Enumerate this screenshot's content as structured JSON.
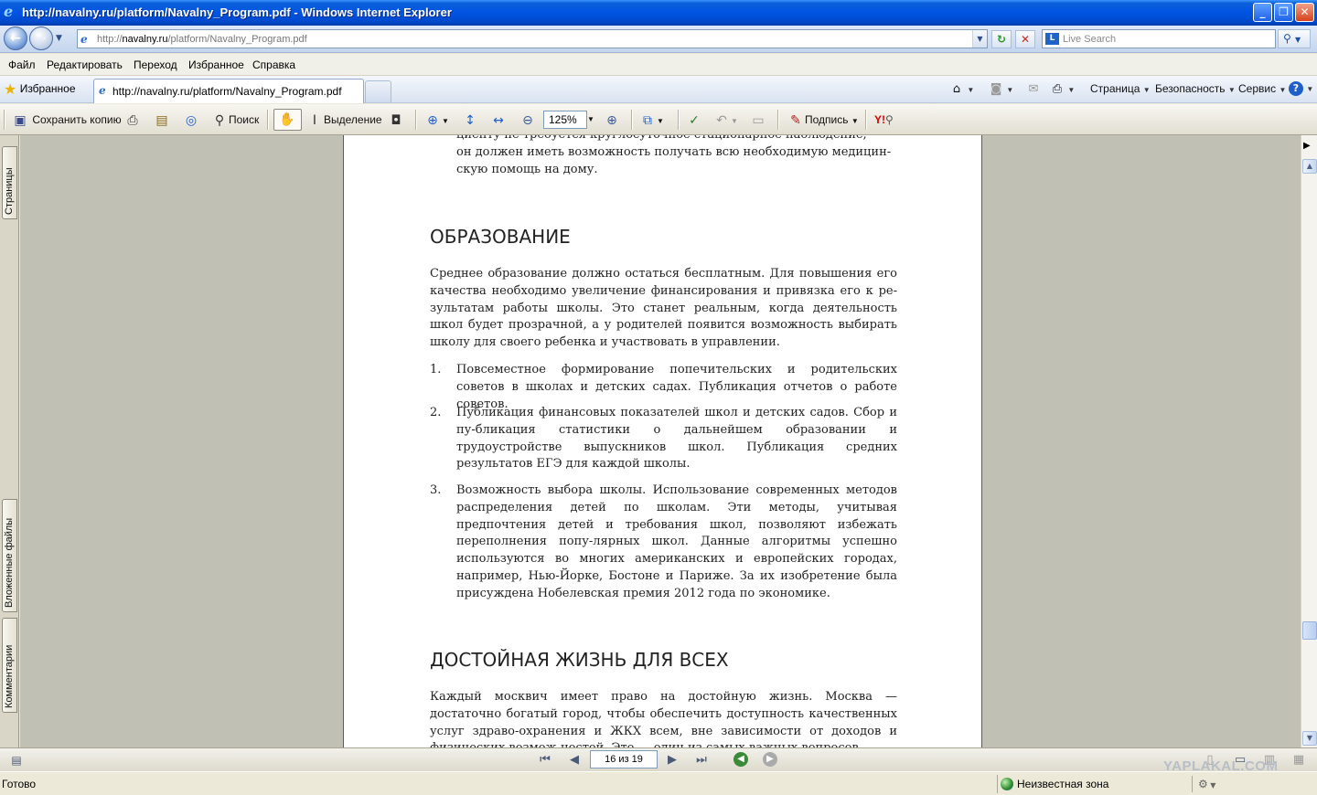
{
  "window": {
    "title": "http://navalny.ru/platform/Navalny_Program.pdf - Windows Internet Explorer"
  },
  "address": {
    "prefix": "http://",
    "domain": "navalny.ru",
    "path": "/platform/Navalny_Program.pdf"
  },
  "search": {
    "placeholder": "Live Search"
  },
  "menu": [
    "Файл",
    "Редактировать",
    "Переход",
    "Избранное",
    "Справка"
  ],
  "favorites_label": "Избранное",
  "tab_label": "http://navalny.ru/platform/Navalny_Program.pdf",
  "commands": {
    "page": "Страница",
    "security": "Безопасность",
    "service": "Сервис"
  },
  "adobe": {
    "save_copy": "Сохранить копию",
    "search": "Поиск",
    "select": "Выделение",
    "zoom": "125%",
    "sign": "Подпись",
    "yahoo": "Y!"
  },
  "side_tabs": {
    "pages": "Страницы",
    "attachments": "Вложенные файлы",
    "comments": "Комментарии"
  },
  "document": {
    "cont_line0": "циенту не требуется круглосуточное стационарное наблюдение,",
    "cont_line1": "он должен иметь возможность получать всю необходимую медицин-",
    "cont_line2": "скую помощь на дому.",
    "heading1": "ОБРАЗОВАНИЕ",
    "para1": "Среднее образование должно остаться бесплатным. Для повышения его качества необходимо увеличение финансирования и привязка его к ре-зультатам работы школы. Это станет реальным, когда деятельность школ будет прозрачной, а у родителей появится возможность выбирать школу для своего ребенка и участвовать в управлении.",
    "items": [
      {
        "n": "1.",
        "text": "Повсеместное формирование попечительских и родительских советов в школах и детских садах. Публикация отчетов о работе советов."
      },
      {
        "n": "2.",
        "text": "Публикация финансовых показателей школ и детских садов. Сбор и пу-бликация статистики о дальнейшем образовании и трудоустройстве выпускников школ. Публикация средних результатов ЕГЭ для каждой школы."
      },
      {
        "n": "3.",
        "text": "Возможность выбора школы. Использование современных методов распределения детей по школам. Эти методы, учитывая предпочтения детей и требования школ, позволяют избежать переполнения попу-лярных школ. Данные алгоритмы успешно используются во многих американских и европейских городах, например, Нью-Йорке, Бостоне и Париже. За их изобретение была присуждена Нобелевская премия 2012 года по экономике."
      }
    ],
    "heading2": "ДОСТОЙНАЯ ЖИЗНЬ ДЛЯ ВСЕХ",
    "para2": "Каждый москвич имеет право на достойную жизнь. Москва — достаточно богатый город, чтобы обеспечить доступность качественных услуг здраво-охранения и ЖКХ всем, вне зависимости от доходов и физических возмож-ностей. Это — один из самых важных вопросов"
  },
  "navigation": {
    "page_indicator": "16 из 19"
  },
  "status": {
    "text": "Готово",
    "zone": "Неизвестная зона"
  },
  "watermark": "YAPLAKAL.COM"
}
